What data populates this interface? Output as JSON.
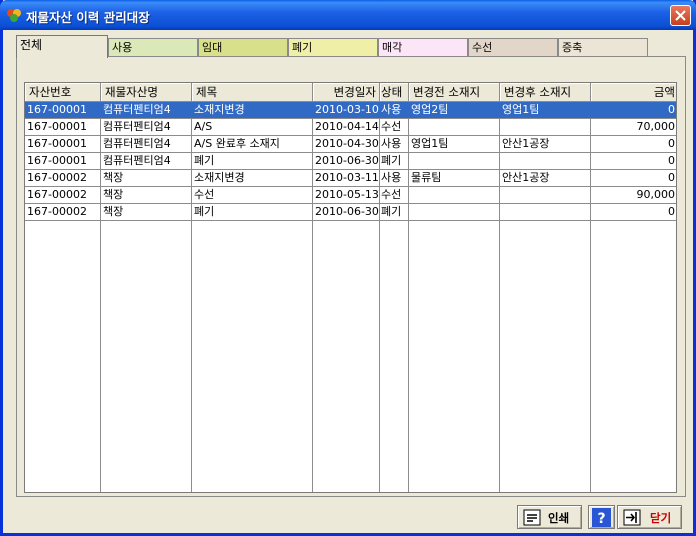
{
  "window": {
    "title": "재물자산 이력 관리대장"
  },
  "tabs": [
    {
      "label": "전체",
      "color": "#ece9d8"
    },
    {
      "label": "사용",
      "color": "#dbe8b8"
    },
    {
      "label": "임대",
      "color": "#d8e08a"
    },
    {
      "label": "폐기",
      "color": "#f0efa8"
    },
    {
      "label": "매각",
      "color": "#fbe5f6"
    },
    {
      "label": "수선",
      "color": "#e2d6c8"
    },
    {
      "label": "증축",
      "color": "#ece4d4"
    }
  ],
  "table": {
    "columns": [
      "자산번호",
      "재물자산명",
      "제목",
      "변경일자",
      "상태",
      "변경전 소재지",
      "변경후 소재지",
      "금액"
    ],
    "rows": [
      [
        "167-00001",
        "컴퓨터펜티엄4",
        "소재지변경",
        "2010-03-10",
        "사용",
        "영업2팀",
        "영업1팀",
        "0"
      ],
      [
        "167-00001",
        "컴퓨터펜티엄4",
        "A/S",
        "2010-04-14",
        "수선",
        "",
        "",
        "70,000"
      ],
      [
        "167-00001",
        "컴퓨터펜티엄4",
        "A/S 완료후 소재지",
        "2010-04-30",
        "사용",
        "영업1팀",
        "안산1공장",
        "0"
      ],
      [
        "167-00001",
        "컴퓨터펜티엄4",
        "폐기",
        "2010-06-30",
        "폐기",
        "",
        "",
        "0"
      ],
      [
        "167-00002",
        "책장",
        "소재지변경",
        "2010-03-11",
        "사용",
        "물류팀",
        "안산1공장",
        "0"
      ],
      [
        "167-00002",
        "책장",
        "수선",
        "2010-05-13",
        "수선",
        "",
        "",
        "90,000"
      ],
      [
        "167-00002",
        "책장",
        "폐기",
        "2010-06-30",
        "폐기",
        "",
        "",
        "0"
      ]
    ]
  },
  "buttons": {
    "print": "인쇄",
    "help": "?",
    "close": "닫기"
  },
  "colors": {
    "selection": "#316ac5",
    "close_label": "#cc0000"
  }
}
